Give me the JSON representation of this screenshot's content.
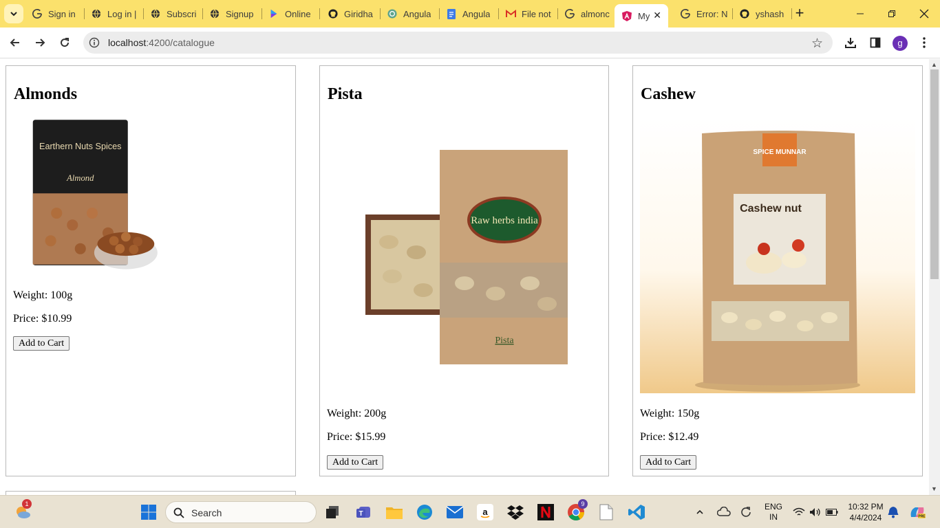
{
  "browser": {
    "tabs": [
      {
        "title": "Sign in",
        "icon": "google-g-icon"
      },
      {
        "title": "Log in |",
        "icon": "globe-icon"
      },
      {
        "title": "Subscri",
        "icon": "globe-icon"
      },
      {
        "title": "Signup",
        "icon": "globe-icon"
      },
      {
        "title": "Online",
        "icon": "canva-icon"
      },
      {
        "title": "Giridha",
        "icon": "github-icon"
      },
      {
        "title": "Angula",
        "icon": "chatgpt-icon"
      },
      {
        "title": "Angula",
        "icon": "google-docs-icon"
      },
      {
        "title": "File not",
        "icon": "gmail-icon"
      },
      {
        "title": "almonc",
        "icon": "google-g-icon"
      },
      {
        "title": "My",
        "icon": "angular-icon",
        "active": true
      },
      {
        "title": "Error: N",
        "icon": "google-g-icon"
      },
      {
        "title": "yshash",
        "icon": "github-icon"
      }
    ],
    "url_host": "localhost",
    "url_path": ":4200/catalogue",
    "profile_initial": "g",
    "accent_color": "#fbe16c"
  },
  "catalogue": {
    "products": [
      {
        "name": "Almonds",
        "weight": "Weight: 100g",
        "price": "Price: $10.99",
        "button": "Add to Cart",
        "image": "almond-pouch-image",
        "package_text": "Earthern Nuts Spices",
        "package_label": "Almond"
      },
      {
        "name": "Pista",
        "weight": "Weight: 200g",
        "price": "Price: $15.99",
        "button": "Add to Cart",
        "image": "pista-pouch-image",
        "package_text": "Raw herbs india",
        "package_label": "Pista"
      },
      {
        "name": "Cashew",
        "weight": "Weight: 150g",
        "price": "Price: $12.49",
        "button": "Add to Cart",
        "image": "cashew-pouch-image",
        "package_text": "SPICE MUNNAR",
        "package_label": "Cashew nut"
      }
    ]
  },
  "taskbar": {
    "search_label": "Search",
    "widgets_badge": "1",
    "chrome_badge": "9",
    "lang_top": "ENG",
    "lang_bottom": "IN",
    "time": "10:32 PM",
    "date": "4/4/2024"
  }
}
